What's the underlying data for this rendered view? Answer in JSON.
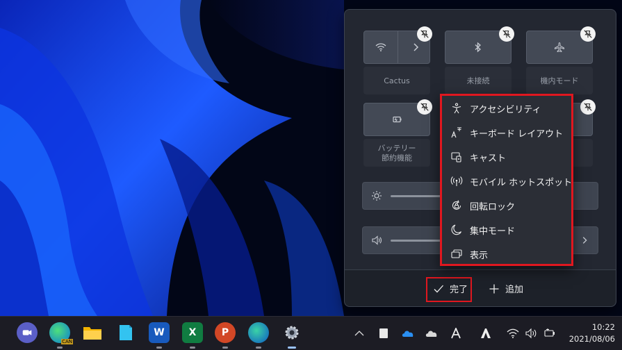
{
  "quick_settings": {
    "tiles": [
      {
        "label": "Cactus",
        "icon": "wifi-icon"
      },
      {
        "label": "未接続",
        "icon": "bluetooth-icon"
      },
      {
        "label": "機内モード",
        "icon": "airplane-icon"
      },
      {
        "label_line1": "バッテリー",
        "label_line2": "節約機能",
        "icon": "battery-saver-icon"
      }
    ],
    "brightness_icon": "sun-icon",
    "volume_icon": "speaker-icon",
    "footer": {
      "done_label": "完了",
      "add_label": "追加"
    }
  },
  "add_menu": {
    "items": [
      {
        "label": "アクセシビリティ",
        "icon": "accessibility-icon"
      },
      {
        "label": "キーボード レイアウト",
        "icon": "keyboard-layout-icon"
      },
      {
        "label": "キャスト",
        "icon": "cast-icon"
      },
      {
        "label": "モバイル ホットスポット",
        "icon": "hotspot-icon"
      },
      {
        "label": "回転ロック",
        "icon": "rotation-lock-icon"
      },
      {
        "label": "集中モード",
        "icon": "focus-moon-icon"
      },
      {
        "label": "表示",
        "icon": "project-display-icon"
      }
    ]
  },
  "taskbar": {
    "apps": [
      "teams-chat-icon",
      "edge-can-icon",
      "file-explorer-icon",
      "notepad-icon",
      "word-icon",
      "excel-icon",
      "powerpoint-icon",
      "edge-icon",
      "settings-icon"
    ],
    "tray": [
      "chevron-up-icon",
      "tablet-icon",
      "onedrive-icon",
      "cloud-icon",
      "font-a-icon",
      "adobe-icon",
      "wifi-icon",
      "volume-icon",
      "battery-icon"
    ],
    "app_letters": {
      "word": "W",
      "excel": "X",
      "powerpoint": "P",
      "can": "CAN"
    },
    "time": "10:22",
    "date": "2021/08/06"
  },
  "colors": {
    "highlight": "#e0171f",
    "accent_blue": "#1a56ff"
  }
}
